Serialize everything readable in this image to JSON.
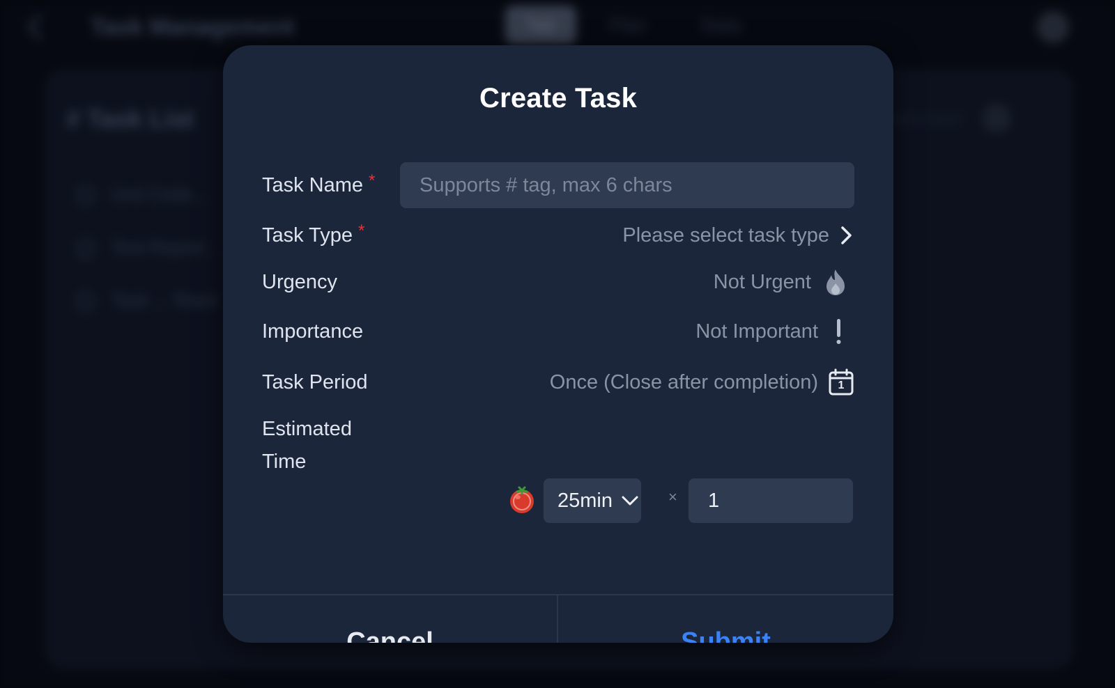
{
  "background": {
    "app_title": "Task Management",
    "tabs": [
      "Tab",
      "Plan",
      "Stats"
    ],
    "list_title": "# Task List",
    "rows": [
      "Unit Code...",
      "Test Report...",
      "Task ... Read"
    ],
    "right_text": "Unfinished"
  },
  "modal": {
    "title": "Create Task",
    "task_name": {
      "label": "Task Name",
      "required_mark": "*",
      "placeholder": "Supports # tag, max 6 chars",
      "value": ""
    },
    "task_type": {
      "label": "Task Type",
      "required_mark": "*",
      "value": "Please select task type",
      "icon": "chevron-right-icon"
    },
    "urgency": {
      "label": "Urgency",
      "value": "Not Urgent",
      "icon": "flame-icon"
    },
    "importance": {
      "label": "Importance",
      "value": "Not Important",
      "icon": "exclamation-icon"
    },
    "task_period": {
      "label": "Task Period",
      "value": "Once (Close after completion)",
      "icon": "calendar-icon",
      "calendar_day": "1"
    },
    "estimated_time": {
      "label_line1": "Estimated",
      "label_line2": "Time",
      "icon": "tomato-icon",
      "duration": "25min",
      "multiplier": "×",
      "count": "1"
    },
    "cancel_label": "Cancel",
    "submit_label": "Submit"
  },
  "colors": {
    "modal_bg": "#1b263a",
    "input_bg": "#2f3b51",
    "required": "#e0353f",
    "submit": "#3b82f6"
  }
}
